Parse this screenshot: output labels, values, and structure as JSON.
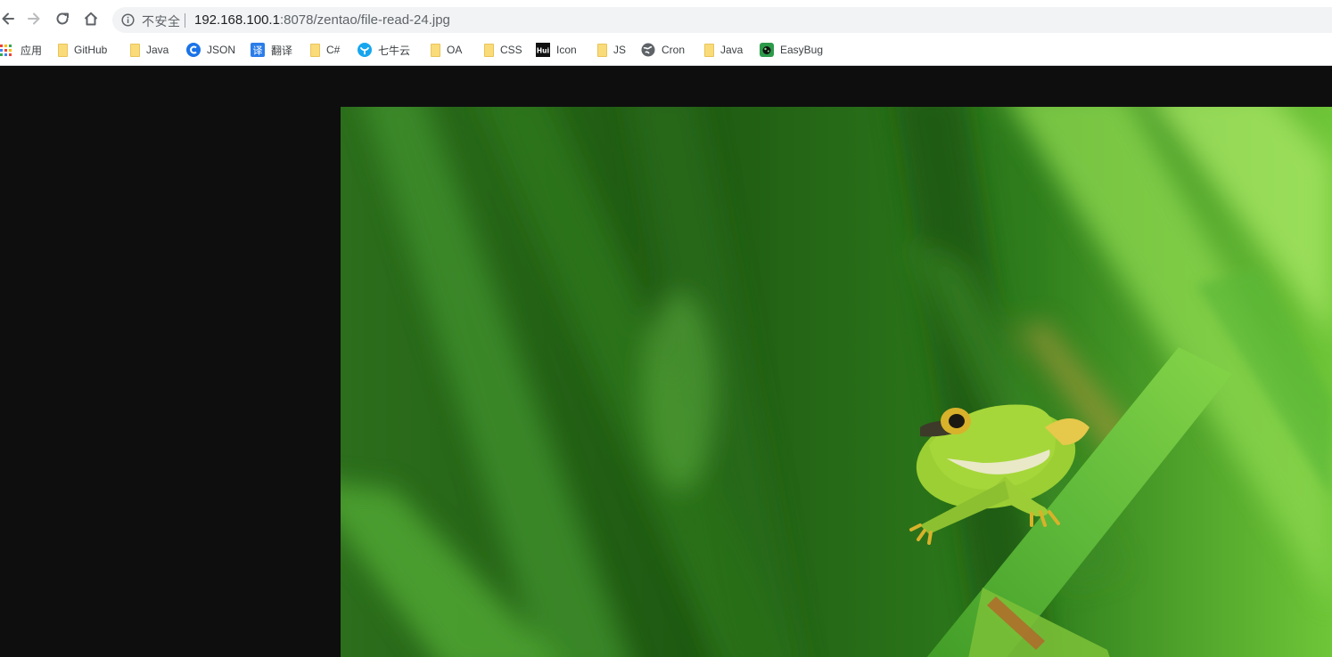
{
  "browser": {
    "nav": {
      "back_icon": "arrow-left-icon",
      "forward_icon": "arrow-right-icon",
      "reload_icon": "reload-icon",
      "home_icon": "home-icon"
    },
    "omnibox": {
      "security_icon": "info-circle-icon",
      "security_label": "不安全",
      "url_host": "192.168.100.1",
      "url_path": ":8078/zentao/file-read-24.jpg"
    },
    "bookmarks": [
      {
        "label": "应用",
        "icon": "apps-grid-icon"
      },
      {
        "label": "GitHub",
        "icon": "folder-icon"
      },
      {
        "label": "Java",
        "icon": "folder-icon"
      },
      {
        "label": "JSON",
        "icon": "json-site-icon"
      },
      {
        "label": "翻译",
        "icon": "translate-icon"
      },
      {
        "label": "C#",
        "icon": "folder-icon"
      },
      {
        "label": "七牛云",
        "icon": "qiniu-icon"
      },
      {
        "label": "OA",
        "icon": "folder-icon"
      },
      {
        "label": "CSS",
        "icon": "folder-icon"
      },
      {
        "label": "Icon",
        "icon": "hui-icon",
        "icon_text": "Hui"
      },
      {
        "label": "JS",
        "icon": "folder-icon"
      },
      {
        "label": "Cron",
        "icon": "globe-icon"
      },
      {
        "label": "Java",
        "icon": "folder-icon"
      },
      {
        "label": "EasyBug",
        "icon": "easybug-icon"
      }
    ]
  },
  "colors": {
    "viewer_background": "#0e0e0e",
    "folder": "#fadb7a",
    "accent_blue": "#1a73e8"
  },
  "image": {
    "subject": "frog-on-grass-photo"
  }
}
